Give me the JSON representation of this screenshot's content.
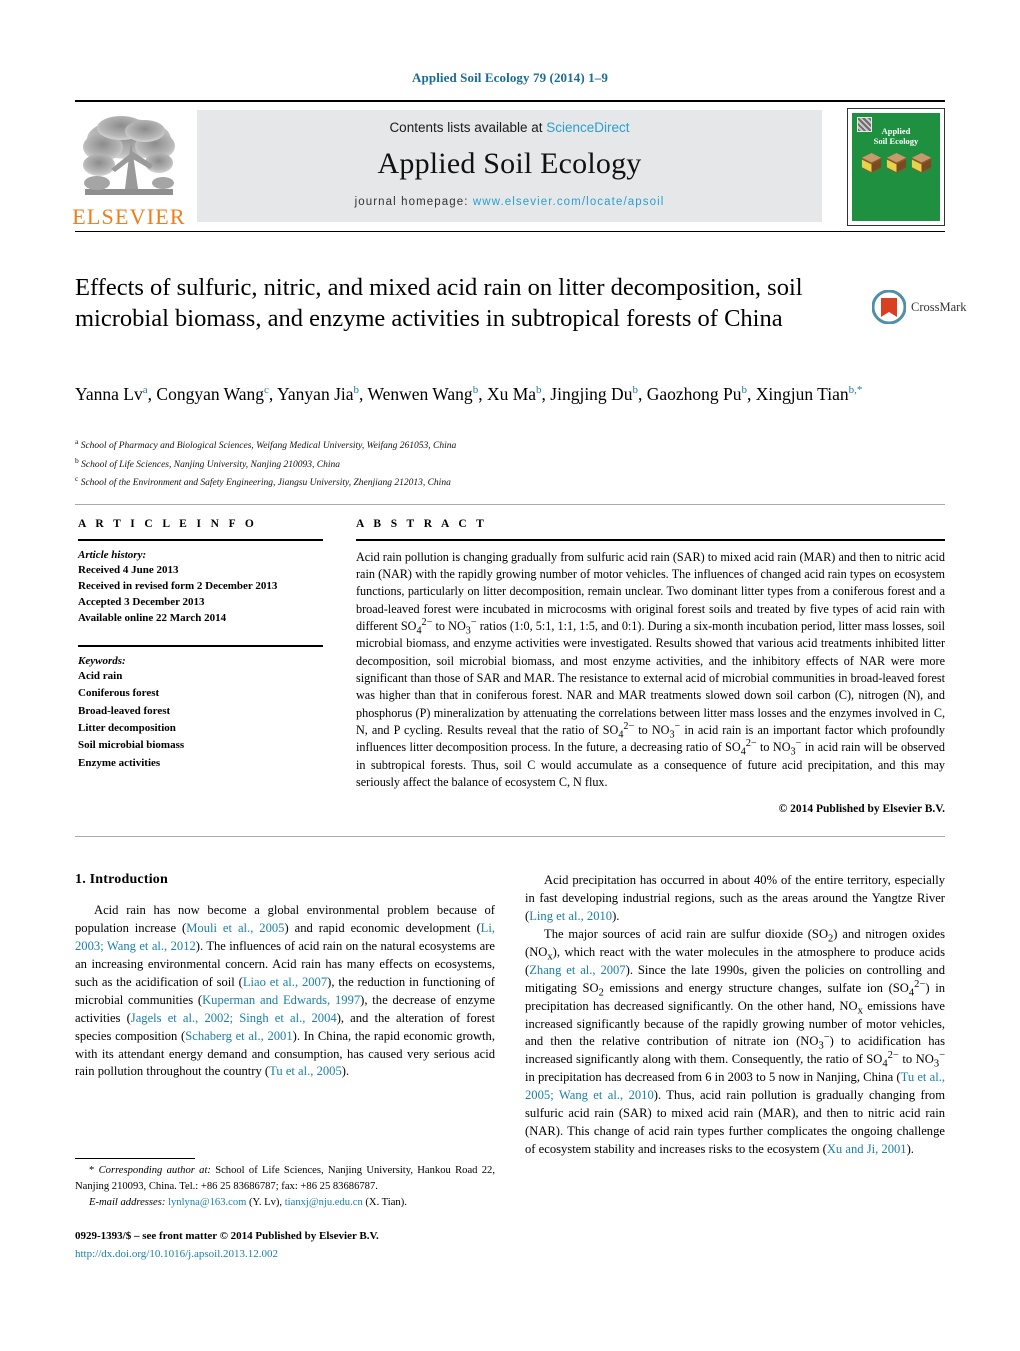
{
  "running_head": "Applied Soil Ecology 79 (2014) 1–9",
  "masthead": {
    "contents_prefix": "Contents lists available at ",
    "contents_link": "ScienceDirect",
    "journal_title": "Applied Soil Ecology",
    "homepage_prefix": "journal homepage: ",
    "homepage_url": "www.elsevier.com/locate/apsoil",
    "publisher_logo_text": "ELSEVIER",
    "cover_title_line1": "Applied",
    "cover_title_line2": "Soil Ecology",
    "accent_link_color": "#2a9fd0",
    "brand_orange": "#f07d1a",
    "cover_green": "#1f9040"
  },
  "article": {
    "title": "Effects of sulfuric, nitric, and mixed acid rain on litter decomposition, soil microbial biomass, and enzyme activities in subtropical forests of China",
    "crossmark_label": "CrossMark",
    "authors_html": "Yanna Lv<sup>a</sup>, Congyan Wang<sup>c</sup>, Yanyan Jia<sup>b</sup>, Wenwen Wang<sup>b</sup>, Xu Ma<sup>b</sup>, Jingjing Du<sup>b</sup>, Gaozhong Pu<sup>b</sup>, Xingjun Tian<sup>b,</sup><sup>*</sup>",
    "affiliations": [
      {
        "mark": "a",
        "text": "School of Pharmacy and Biological Sciences, Weifang Medical University, Weifang 261053, China"
      },
      {
        "mark": "b",
        "text": "School of Life Sciences, Nanjing University, Nanjing 210093, China"
      },
      {
        "mark": "c",
        "text": "School of the Environment and Safety Engineering, Jiangsu University, Zhenjiang 212013, China"
      }
    ]
  },
  "article_info": {
    "heading": "A R T I C L E   I N F O",
    "history_label": "Article history:",
    "history": [
      "Received 4 June 2013",
      "Received in revised form 2 December 2013",
      "Accepted 3 December 2013",
      "Available online 22 March 2014"
    ],
    "keywords_label": "Keywords:",
    "keywords": [
      "Acid rain",
      "Coniferous forest",
      "Broad-leaved forest",
      "Litter decomposition",
      "Soil microbial biomass",
      "Enzyme activities"
    ]
  },
  "abstract": {
    "heading": "A B S T R A C T",
    "paragraph_html": "Acid rain pollution is changing gradually from sulfuric acid rain (SAR) to mixed acid rain (MAR) and then to nitric acid rain (NAR) with the rapidly growing number of motor vehicles. The influences of changed acid rain types on ecosystem functions, particularly on litter decomposition, remain unclear. Two dominant litter types from a coniferous forest and a broad-leaved forest were incubated in microcosms with original forest soils and treated by five types of acid rain with different SO<sub>4</sub><sup>2−</sup> to NO<sub>3</sub><sup>−</sup> ratios (1:0, 5:1, 1:1, 1:5, and 0:1). During a six-month incubation period, litter mass losses, soil microbial biomass, and enzyme activities were investigated. Results showed that various acid treatments inhibited litter decomposition, soil microbial biomass, and most enzyme activities, and the inhibitory effects of NAR were more significant than those of SAR and MAR. The resistance to external acid of microbial communities in broad-leaved forest was higher than that in coniferous forest. NAR and MAR treatments slowed down soil carbon (C), nitrogen (N), and phosphorus (P) mineralization by attenuating the correlations between litter mass losses and the enzymes involved in C, N, and P cycling. Results reveal that the ratio of SO<sub>4</sub><sup>2−</sup> to NO<sub>3</sub><sup>−</sup> in acid rain is an important factor which profoundly influences litter decomposition process. In the future, a decreasing ratio of SO<sub>4</sub><sup>2−</sup> to NO<sub>3</sub><sup>−</sup> in acid rain will be observed in subtropical forests. Thus, soil C would accumulate as a consequence of future acid precipitation, and this may seriously affect the balance of ecosystem C, N flux.",
    "copyright": "© 2014 Published by Elsevier B.V."
  },
  "body": {
    "section_heading": "1. Introduction",
    "left_paragraphs_html": [
      "Acid rain has now become a global environmental problem because of population increase (<span class=\"cite\">Mouli et al., 2005</span>) and rapid economic development (<span class=\"cite\">Li, 2003; Wang et al., 2012</span>). The influences of acid rain on the natural ecosystems are an increasing environmental concern. Acid rain has many effects on ecosystems, such as the acidification of soil (<span class=\"cite\">Liao et al., 2007</span>), the reduction in functioning of microbial communities (<span class=\"cite\">Kuperman and Edwards, 1997</span>), the decrease of enzyme activities (<span class=\"cite\">Jagels et al., 2002; Singh et al., 2004</span>), and the alteration of forest species composition (<span class=\"cite\">Schaberg et al., 2001</span>). In China, the rapid economic growth, with its attendant energy demand and consumption, has caused very serious acid rain pollution throughout the country (<span class=\"cite\">Tu et al., 2005</span>)."
    ],
    "right_paragraphs_html": [
      "Acid precipitation has occurred in about 40% of the entire territory, especially in fast developing industrial regions, such as the areas around the Yangtze River (<span class=\"cite\">Ling et al., 2010</span>).",
      "The major sources of acid rain are sulfur dioxide (SO<sub>2</sub>) and nitrogen oxides (NO<sub>x</sub>), which react with the water molecules in the atmosphere to produce acids (<span class=\"cite\">Zhang et al., 2007</span>). Since the late 1990s, given the policies on controlling and mitigating SO<sub>2</sub> emissions and energy structure changes, sulfate ion (SO<sub>4</sub><sup>2−</sup>) in precipitation has decreased significantly. On the other hand, NO<sub>x</sub> emissions have increased significantly because of the rapidly growing number of motor vehicles, and then the relative contribution of nitrate ion (NO<sub>3</sub><sup>−</sup>) to acidification has increased significantly along with them. Consequently, the ratio of SO<sub>4</sub><sup>2−</sup> to NO<sub>3</sub><sup>−</sup> in precipitation has decreased from 6 in 2003 to 5 now in Nanjing, China (<span class=\"cite\">Tu et al., 2005; Wang et al., 2010</span>). Thus, acid rain pollution is gradually changing from sulfuric acid rain (SAR) to mixed acid rain (MAR), and then to nitric acid rain (NAR). This change of acid rain types further complicates the ongoing challenge of ecosystem stability and increases risks to the ecosystem (<span class=\"cite\">Xu and Ji, 2001</span>)."
    ]
  },
  "footer": {
    "corresponding_html": "<span class=\"fn-ind\">* <i>Corresponding author at:</i> School of Life Sciences, Nanjing University, Hankou Road 22, Nanjing 210093, China. Tel.: +86 25 83686787; fax: +86 25 83686787.</span>",
    "email_html": "<span class=\"fn-ind\"><i>E-mail addresses:</i> <span class=\"cite\">lynlyna@163.com</span> (Y. Lv), <span class=\"cite\">tianxj@nju.edu.cn</span> (X. Tian).</span>",
    "imprint": "0929-1393/$ – see front matter © 2014 Published by Elsevier B.V.",
    "doi": "http://dx.doi.org/10.1016/j.apsoil.2013.12.002"
  }
}
